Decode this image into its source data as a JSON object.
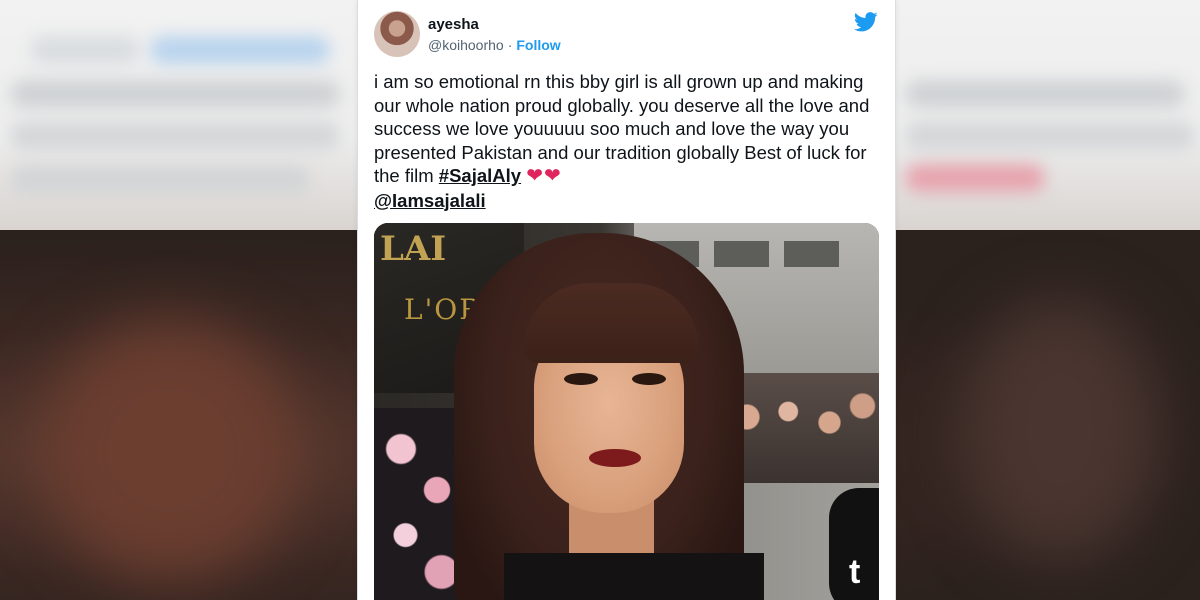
{
  "tweet": {
    "author_name": "ayesha",
    "handle": "@koihoorho",
    "separator": "·",
    "follow_label": "Follow",
    "text": "i am so emotional rn this bby girl is all grown up and making our whole nation proud globally. you deserve all the love and success we love youuuuu soo much and love the way you presented Pakistan and our tradition globally Best of luck for the film ",
    "hashtag": "#SajalAly",
    "hearts": "❤❤",
    "mention": "@Iamsajalali"
  },
  "media": {
    "sign_top": "LAI",
    "sign_text": "L'ORE",
    "mic_label": "t"
  },
  "icons": {
    "brand": "twitter-bird-icon"
  },
  "colors": {
    "twitter_blue": "#1d9bf0",
    "heart_red": "#e0245e"
  }
}
